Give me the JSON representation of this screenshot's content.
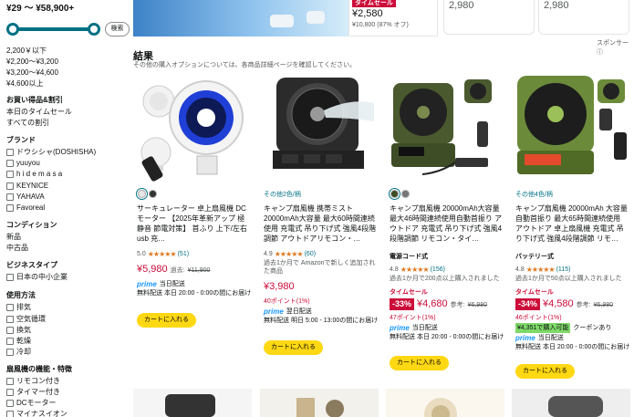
{
  "sidebar": {
    "price_range": "¥29 〜 ¥58,900+",
    "search_button": "検索",
    "price_links": [
      "2,200￥以下",
      "¥2,200〜¥3,200",
      "¥3,200〜¥4,600",
      "¥4,600以上"
    ],
    "deals_heading": "お買い得品&割引",
    "deals_links": [
      "本日のタイムセール",
      "すべての割引"
    ],
    "brand_heading": "ブランド",
    "brands": [
      "ドウシシャ(DOSHISHA)",
      "yuuyou",
      "h i d e m a s a",
      "KEYNICE",
      "YAHAVA",
      "Favoreal"
    ],
    "condition_heading": "コンディション",
    "conditions": [
      "新品",
      "中古品"
    ],
    "business_heading": "ビジネスタイプ",
    "business": [
      "日本の中小企業"
    ],
    "usage_heading": "使用方法",
    "usages": [
      "排気",
      "空気循環",
      "換気",
      "乾燥",
      "冷却"
    ],
    "features_heading": "扇風機の機能・特徴",
    "features": [
      "リモコン付き",
      "タイマー付き",
      "DCモーター",
      "マイナスイオン"
    ]
  },
  "top_strip": {
    "deal_tag": "タイムセール",
    "price": "¥2,580",
    "old_price": "¥10,800 (87% オフ)",
    "card2_price": "2,980",
    "card3_price": "2,980",
    "sponsor": "スポンサー ⓘ"
  },
  "results": {
    "title": "結果",
    "subtitle": "その他の購入オプションについては、各商品詳細ページを確認してください。"
  },
  "products": [
    {
      "title": "サーキュレーター 卓上扇風機 DC モーター 【2025年革新アップ 極静音 節電対策】 首ふり 上下/左右 usb 充…",
      "rating": "5.0",
      "stars": "★★★★★",
      "count": "(51)",
      "price": "¥5,980",
      "ref_label": "過去:",
      "old_price": "¥11,900",
      "prime": "prime",
      "prime_note": "当日配送",
      "shipping": "無料配送 本日 20:00 - 0:00の間にお届け",
      "cart": "カートに入れる"
    },
    {
      "other_colors": "その他2色/柄",
      "title": "キャンプ扇風機 携帯ミスト 20000mAh大容量 最大60時間連続使用 充電式 吊り下げ式 強風4段階調節 アウトドアリモコン・…",
      "rating": "4.9",
      "stars": "★★★★★",
      "count": "(60)",
      "past": "過去1か月で Amazonで新しく追加された商品",
      "price": "¥3,980",
      "points": "40ポイント(1%)",
      "prime": "prime",
      "prime_note": "翌日配送",
      "shipping": "無料配送 明日 5:00 - 13:00の間にお届け",
      "cart": "カートに入れる"
    },
    {
      "title": "キャンプ扇風機 20000mAh大容量 最大46時間連続使用自動首振り アウトドア 充電式 吊り下げ式 強風4段階調節 リモコン・タイ…",
      "tag": "電源コード式",
      "rating": "4.8",
      "stars": "★★★★★",
      "count": "(156)",
      "past": "過去1か月で200点以上購入されました",
      "timesale": "タイムセール",
      "discount": "-33%",
      "price": "¥4,680",
      "ref_label": "参考:",
      "old_price": "¥6,980",
      "points": "47ポイント(1%)",
      "prime": "prime",
      "prime_note": "当日配送",
      "shipping": "無料配送 本日 20:00 - 0:00の間にお届け",
      "cart": "カートに入れる"
    },
    {
      "other_colors": "その他4色/柄",
      "title": "キャンプ扇風機 20000mAh 大容量 自動首振り 最大65時間連続使用 アウトドア 卓上扇風機 充電式 吊り下げ式 強風4段階調節 リモ…",
      "tag": "バッテリー式",
      "rating": "4.8",
      "stars": "★★★★★",
      "count": "(115)",
      "past": "過去1か月で50点以上購入されました",
      "timesale": "タイムセール",
      "discount": "-34%",
      "price": "¥4,580",
      "ref_label": "参考:",
      "old_price": "¥6,980",
      "points": "46ポイント(1%)",
      "coupon": "¥4,351で購入可能",
      "coupon_note": "クーポンあり",
      "prime": "prime",
      "prime_note": "当日配送",
      "shipping": "無料配送 本日 20:00 - 0:00の間にお届け",
      "cart": "カートに入れる"
    }
  ],
  "colors": {
    "accent": "#007185",
    "deal_red": "#cc0c39",
    "cart_yellow": "#ffd814",
    "star": "#de7921",
    "prime_blue": "#1a98ff"
  }
}
